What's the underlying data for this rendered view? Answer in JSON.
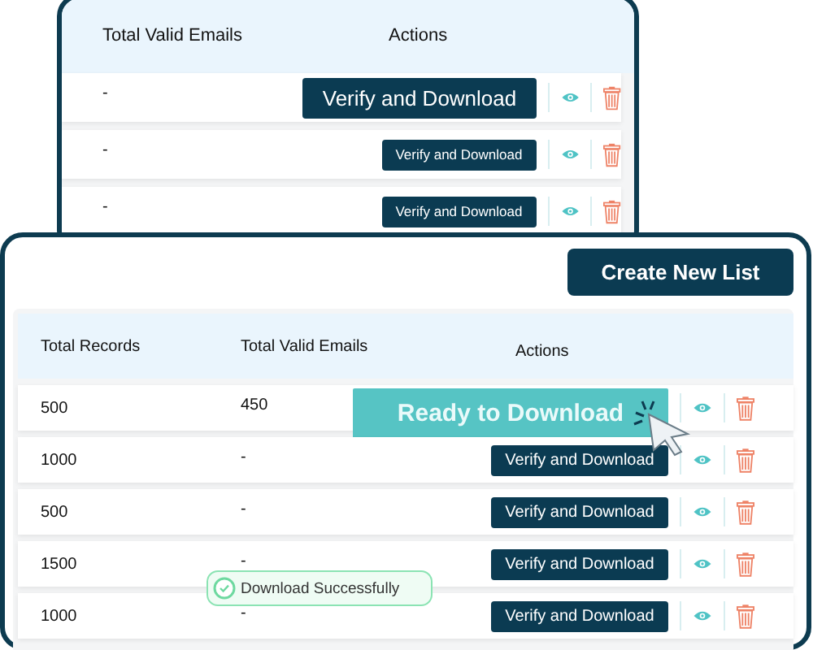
{
  "back_table": {
    "columns": [
      "Total Valid Emails",
      "Actions"
    ],
    "rows": [
      {
        "valid_emails": "-",
        "action": {
          "label": "Verify and Download",
          "kind": "large"
        }
      },
      {
        "valid_emails": "-",
        "action": {
          "label": "Verify and Download",
          "kind": "small"
        }
      },
      {
        "valid_emails": "-",
        "action": {
          "label": "Verify and Download",
          "kind": "small"
        }
      }
    ]
  },
  "create_button": "Create New List",
  "table": {
    "columns": [
      "Total Records",
      "Total Valid Emails",
      "Actions"
    ],
    "rows": [
      {
        "records": "500",
        "valid_emails": "450",
        "action": {
          "label": "Ready to Download",
          "kind": "ready"
        }
      },
      {
        "records": "1000",
        "valid_emails": "-",
        "action": {
          "label": "Verify and Download",
          "kind": "normal"
        }
      },
      {
        "records": "500",
        "valid_emails": "-",
        "action": {
          "label": "Verify and Download",
          "kind": "normal"
        }
      },
      {
        "records": "1500",
        "valid_emails": "-",
        "action": {
          "label": "Verify and Download",
          "kind": "normal"
        }
      },
      {
        "records": "1000",
        "valid_emails": "-",
        "action": {
          "label": "Verify and Download",
          "kind": "normal"
        }
      }
    ]
  },
  "toast": "Download Successfully"
}
